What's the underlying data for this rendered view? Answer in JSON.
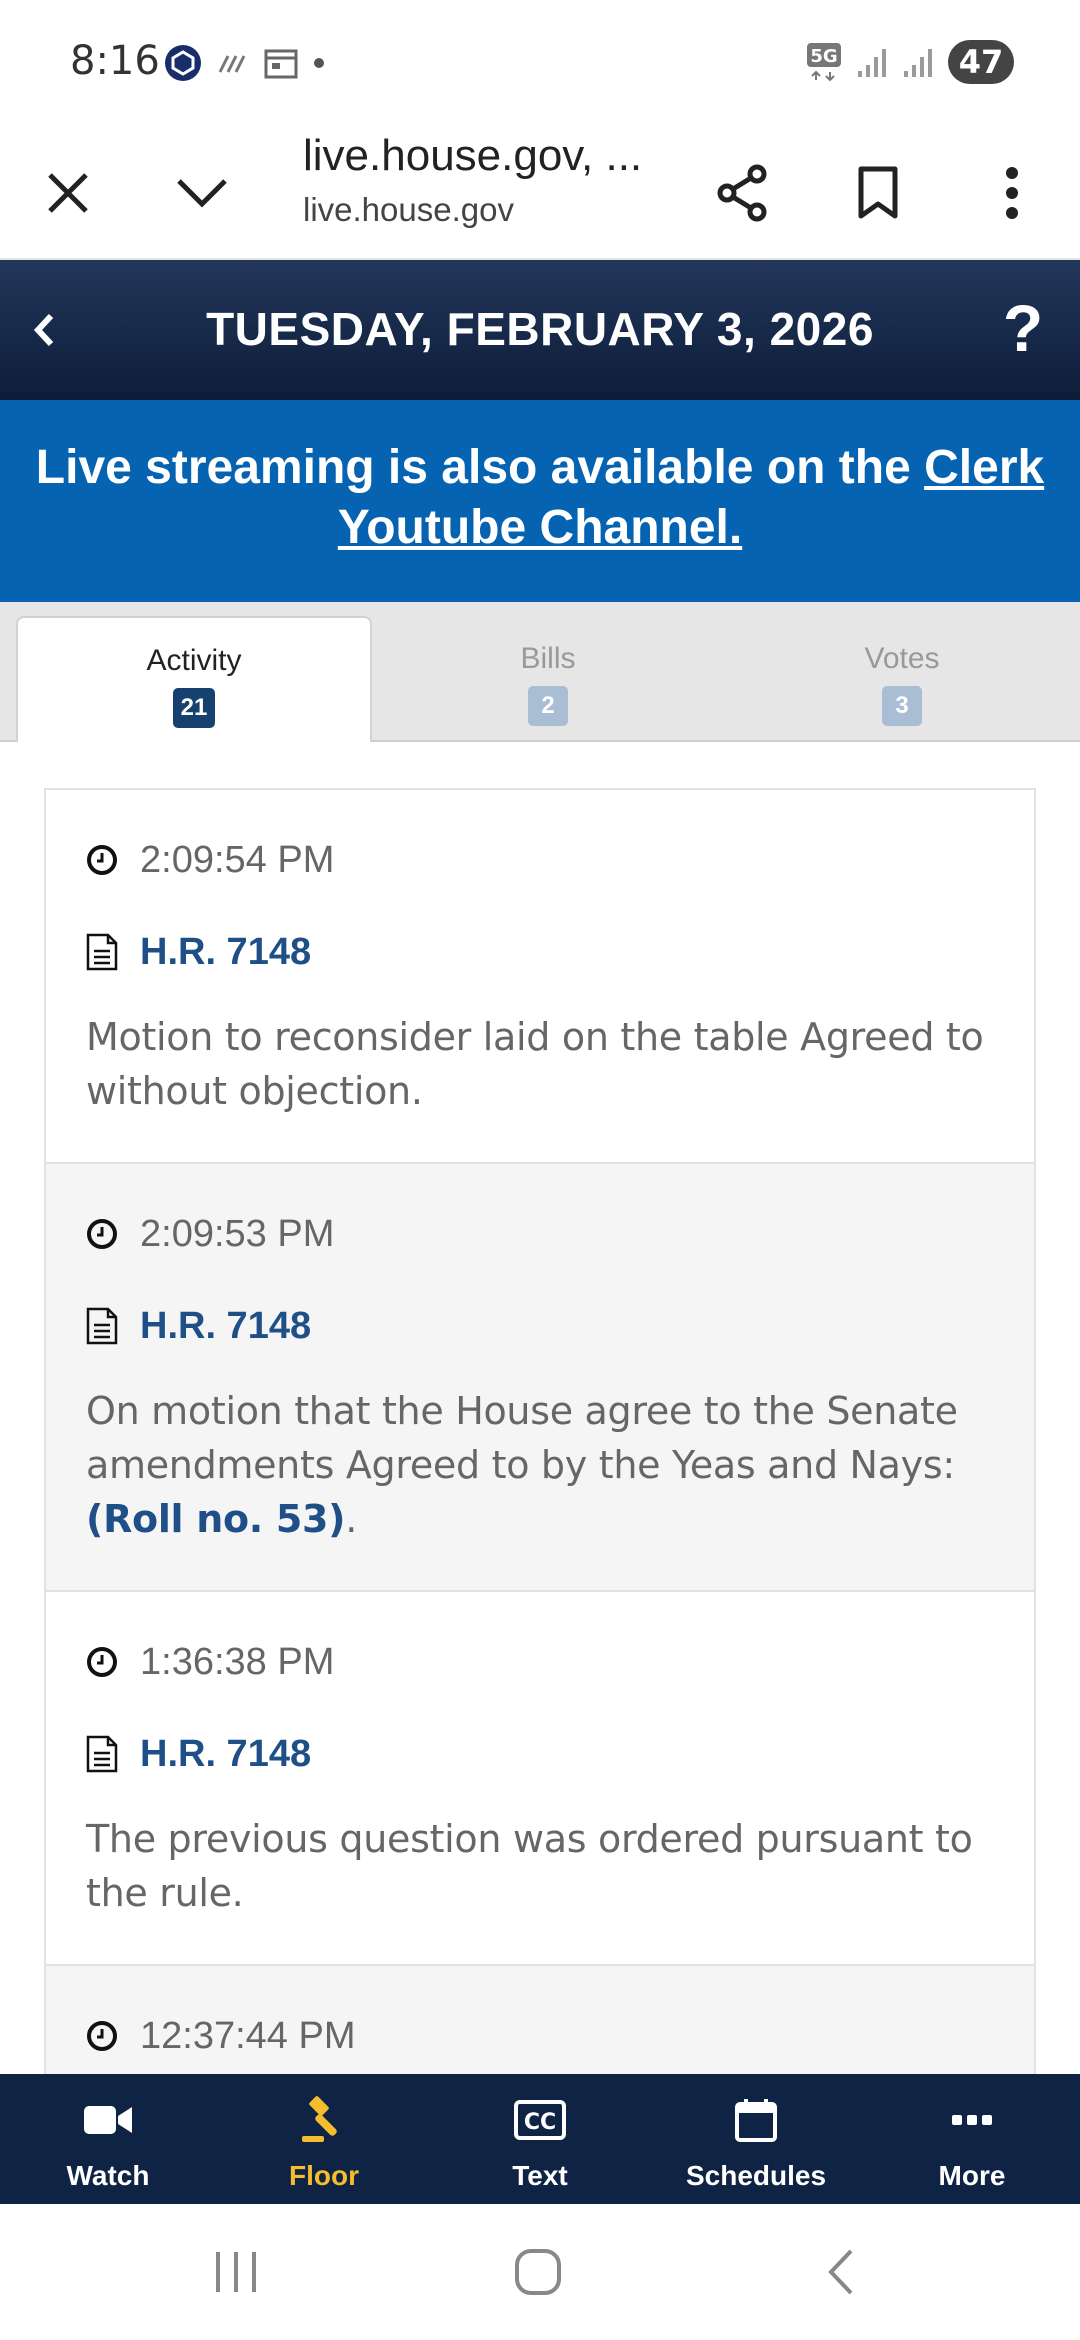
{
  "status_bar": {
    "time": "8:16",
    "battery": "47",
    "network": "5G"
  },
  "browser": {
    "title": "live.house.gov, ...",
    "url": "live.house.gov",
    "icons": [
      "close-icon",
      "chevron-down-icon",
      "share-icon",
      "bookmark-icon",
      "more-vert-icon"
    ]
  },
  "header": {
    "date": "TUESDAY, FEBRUARY 3, 2026",
    "help": "?"
  },
  "banner": {
    "text": "Live streaming is also available on the ",
    "link": "Clerk Youtube Channel."
  },
  "tabs": [
    {
      "label": "Activity",
      "count": "21",
      "active": true
    },
    {
      "label": "Bills",
      "count": "2",
      "active": false
    },
    {
      "label": "Votes",
      "count": "3",
      "active": false
    }
  ],
  "entries": [
    {
      "time": "2:09:54 PM",
      "bill": "H.R. 7148",
      "description": "Motion to reconsider laid on the table Agreed to without objection.",
      "roll": ""
    },
    {
      "time": "2:09:53 PM",
      "bill": "H.R. 7148",
      "description": "On motion that the House agree to the Senate amendments Agreed to by the Yeas and Nays: ",
      "roll": "(Roll no. 53)",
      "suffix": "."
    },
    {
      "time": "1:36:38 PM",
      "bill": "H.R. 7148",
      "description": "The previous question was ordered pursuant to the rule.",
      "roll": ""
    },
    {
      "time": "12:37:44 PM"
    }
  ],
  "bottom_nav": [
    {
      "label": "Watch",
      "icon": "video-camera-icon",
      "active": false
    },
    {
      "label": "Floor",
      "icon": "gavel-icon",
      "active": true
    },
    {
      "label": "Text",
      "icon": "closed-captions-icon",
      "active": false
    },
    {
      "label": "Schedules",
      "icon": "calendar-icon",
      "active": false
    },
    {
      "label": "More",
      "icon": "more-horiz-icon",
      "active": false
    }
  ],
  "colors": {
    "header_dark": "#0d1d39",
    "banner_blue": "#0563b1",
    "link_blue": "#1e4f86",
    "active_gold": "#f3bd2e"
  }
}
